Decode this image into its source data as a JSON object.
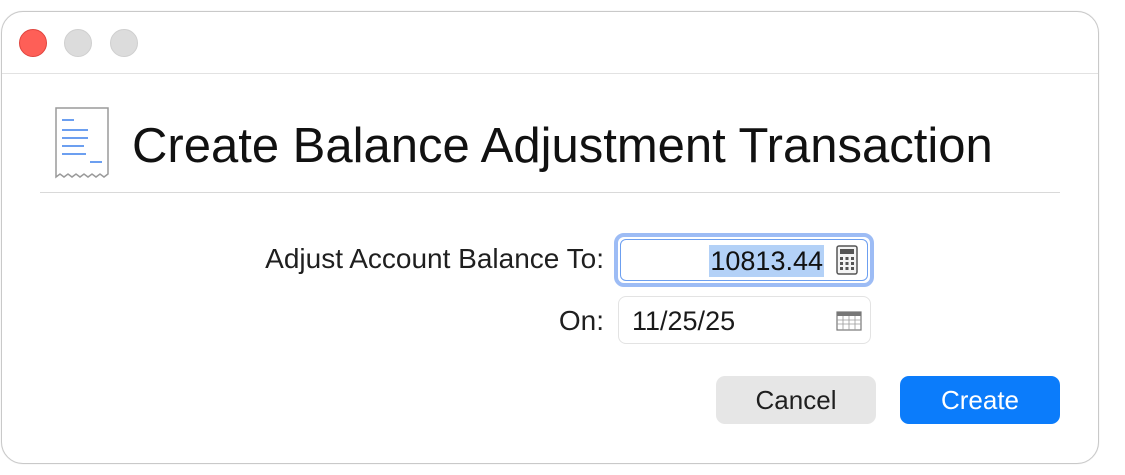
{
  "window": {
    "controls": [
      "close",
      "minimize",
      "zoom"
    ]
  },
  "dialog": {
    "icon": "receipt-icon",
    "title": "Create Balance Adjustment Transaction"
  },
  "form": {
    "balance_label": "Adjust Account Balance To:",
    "balance_value": "10813.44",
    "balance_icon": "calculator-icon",
    "date_label": "On:",
    "date_value": "11/25/25",
    "date_icon": "calendar-icon"
  },
  "buttons": {
    "cancel_label": "Cancel",
    "create_label": "Create"
  },
  "colors": {
    "close": "#fe5f57",
    "accent": "#0b7cfb",
    "selection": "#b3d1f7",
    "focus_ring": "#9dbcf5"
  }
}
